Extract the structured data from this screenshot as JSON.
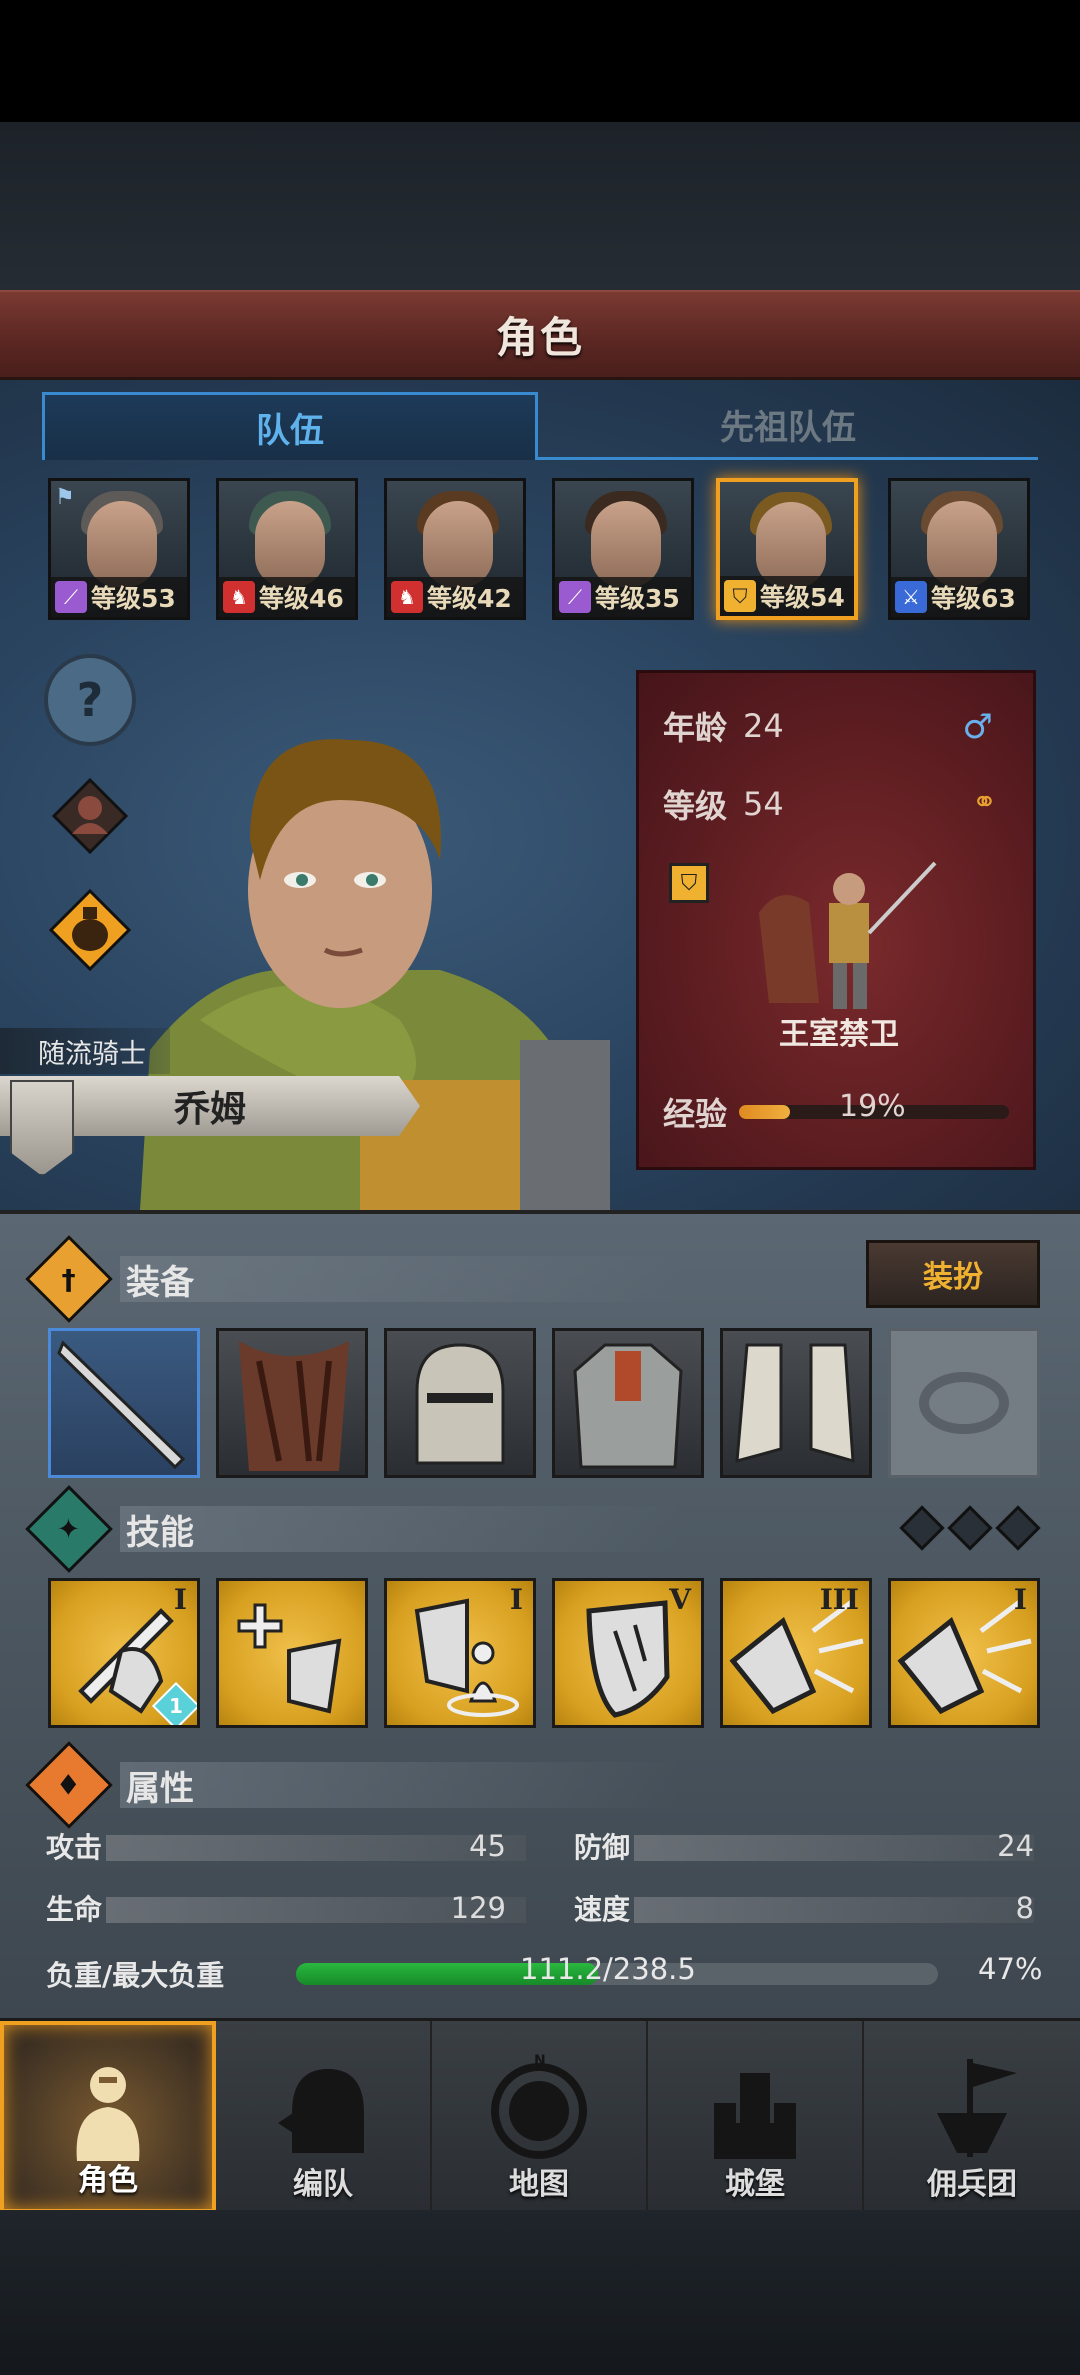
{
  "title": "角色",
  "tabs": [
    {
      "label": "队伍",
      "active": true
    },
    {
      "label": "先祖队伍",
      "active": false
    }
  ],
  "party": [
    {
      "level_label": "等级53",
      "class_icon": "staff-icon",
      "class_color": "#9b5bd0",
      "hair": "#5e5a58",
      "flag": true
    },
    {
      "level_label": "等级46",
      "class_icon": "horse-icon",
      "class_color": "#d03030",
      "hair": "#3e5a50"
    },
    {
      "level_label": "等级42",
      "class_icon": "horse-icon",
      "class_color": "#d03030",
      "hair": "#5a3a20"
    },
    {
      "level_label": "等级35",
      "class_icon": "staff-icon",
      "class_color": "#9b5bd0",
      "hair": "#3a2a20"
    },
    {
      "level_label": "等级54",
      "class_icon": "shield-icon",
      "class_color": "#f0b030",
      "hair": "#7a5a20",
      "selected": true
    },
    {
      "level_label": "等级63",
      "class_icon": "sword-icon",
      "class_color": "#3a6ad8",
      "hair": "#6a4a30"
    }
  ],
  "character": {
    "subtitle": "随流骑士",
    "name": "乔姆",
    "age_label": "年龄",
    "age": "24",
    "level_label": "等级",
    "level": "54",
    "class_name": "王室禁卫",
    "exp_label": "经验",
    "exp_pct": "19%",
    "exp_fraction": 0.19
  },
  "sections": {
    "equipment": "装备",
    "dress_button": "装扮",
    "skills": "技能",
    "attributes": "属性"
  },
  "skills": [
    {
      "rank": "I",
      "badge": "1"
    },
    {
      "rank": ""
    },
    {
      "rank": "I"
    },
    {
      "rank": "V"
    },
    {
      "rank": "III"
    },
    {
      "rank": "I"
    }
  ],
  "stats": {
    "attack_label": "攻击",
    "attack": "45",
    "defense_label": "防御",
    "defense": "24",
    "hp_label": "生命",
    "hp": "129",
    "speed_label": "速度",
    "speed": "8",
    "load_label": "负重/最大负重",
    "load": "111.2/238.5",
    "load_pct": "47%",
    "load_fraction": 0.47
  },
  "nav": [
    {
      "label": "角色",
      "active": true
    },
    {
      "label": "编队"
    },
    {
      "label": "地图"
    },
    {
      "label": "城堡"
    },
    {
      "label": "佣兵团"
    }
  ],
  "colors": {
    "accent": "#f0a020",
    "tab_blue": "#3a8ad0",
    "banner_red": "#5a1c20"
  }
}
